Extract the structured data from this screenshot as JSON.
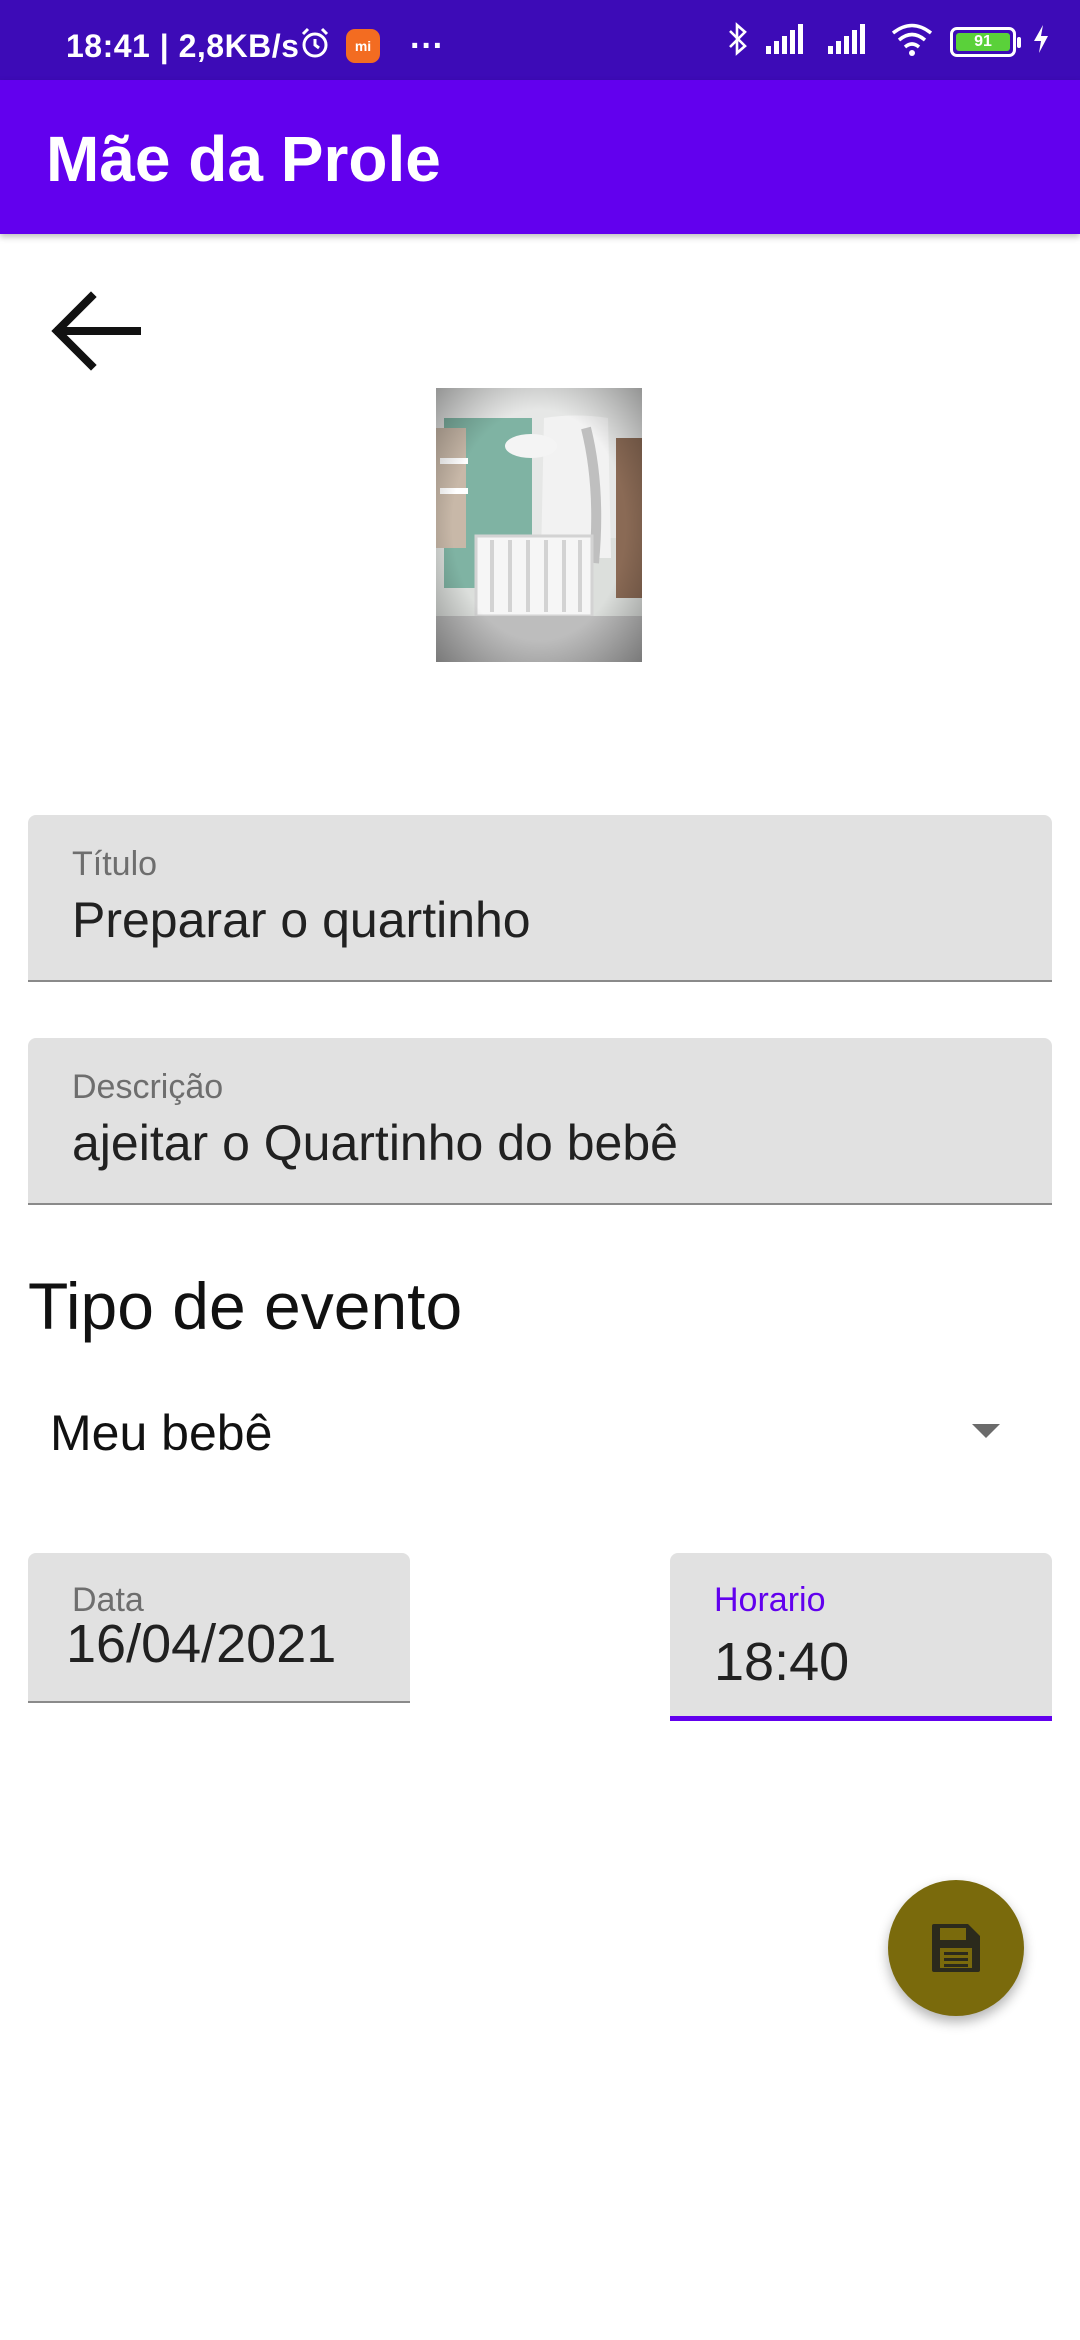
{
  "status_bar": {
    "time": "18:41 | 2,8KB/s",
    "mi_badge": "mi",
    "more": "···",
    "battery": "91"
  },
  "app_bar": {
    "title": "Mãe da Prole"
  },
  "form": {
    "title_field": {
      "label": "Título",
      "value": "Preparar o quartinho"
    },
    "description_field": {
      "label": "Descrição",
      "value": "ajeitar o Quartinho do bebê"
    },
    "event_type": {
      "heading": "Tipo de evento",
      "selected": "Meu bebê"
    },
    "date_field": {
      "label": "Data",
      "value": "16/04/2021"
    },
    "time_field": {
      "label": "Horario",
      "value": "18:40"
    }
  },
  "colors": {
    "status_bar": "#3d0bb7",
    "primary": "#6200ee",
    "fab": "#7a6a0c",
    "field_bg": "#e1e1e1"
  },
  "icons": {
    "back": "arrow-back-icon",
    "fab": "save-icon",
    "status": [
      "alarm-icon",
      "bluetooth-icon",
      "signal-icon",
      "wifi-icon",
      "battery-icon",
      "charging-icon"
    ]
  }
}
